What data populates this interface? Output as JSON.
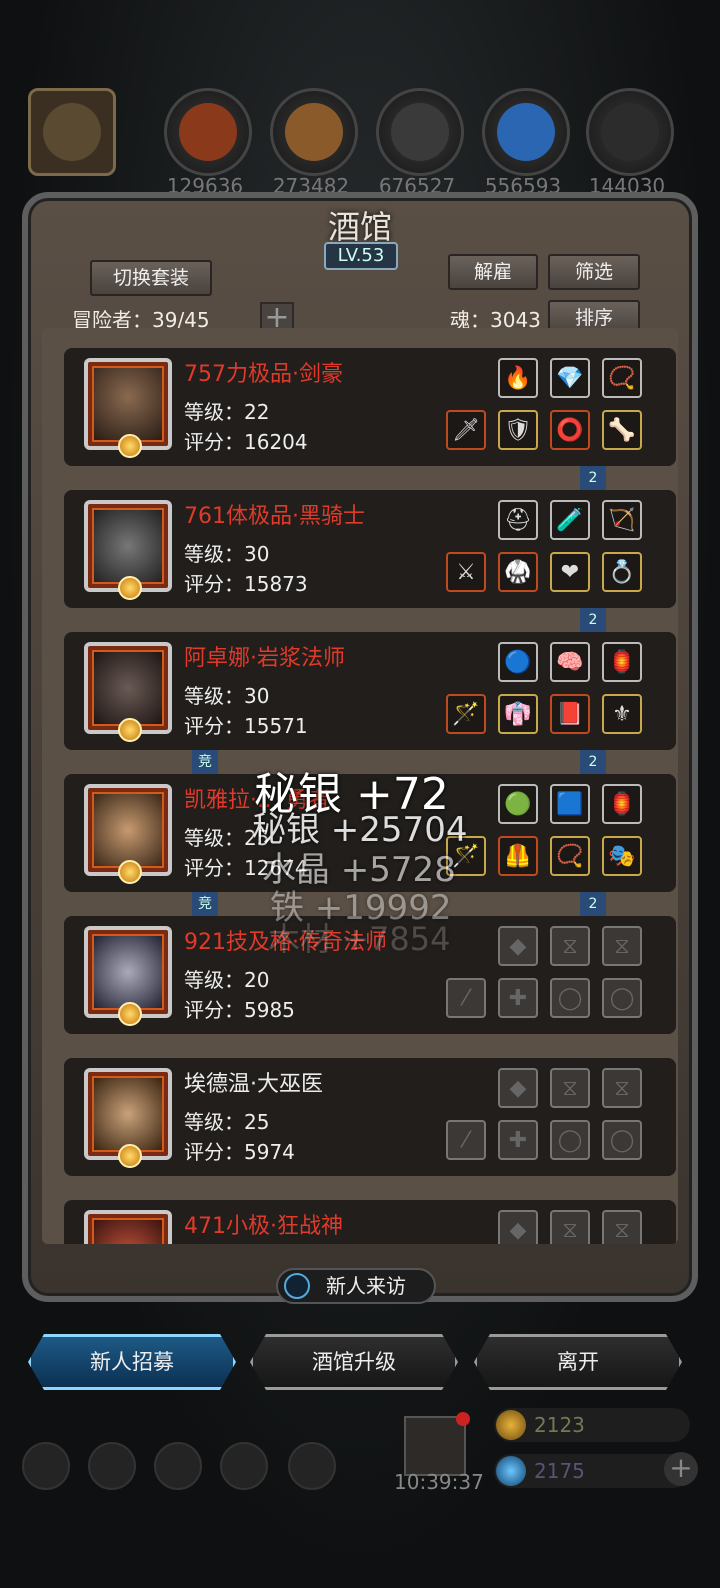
{
  "resources": [
    {
      "name": "tavern-icon",
      "value": ""
    },
    {
      "name": "ore-icon",
      "value": "129636"
    },
    {
      "name": "wood-icon",
      "value": "273482"
    },
    {
      "name": "iron-icon",
      "value": "676527"
    },
    {
      "name": "crystal-icon",
      "value": "556593"
    },
    {
      "name": "stone-icon",
      "value": "144030"
    }
  ],
  "title": "酒馆",
  "level": "LV.53",
  "buttons": {
    "switch_set": "切换套装",
    "dismiss": "解雇",
    "filter": "筛选",
    "sort": "排序"
  },
  "adventurers": "冒险者：39/45",
  "soul": "魂：3043",
  "heroes": [
    {
      "name": "757力极品·剑豪",
      "level": "等级：22",
      "score": "评分：16204",
      "color": "red"
    },
    {
      "name": "761体极品·黑骑士",
      "level": "等级：30",
      "score": "评分：15873",
      "color": "red"
    },
    {
      "name": "阿卓娜·岩浆法师",
      "level": "等级：30",
      "score": "评分：15571",
      "color": "red"
    },
    {
      "name": "凯雅拉·… 勇者",
      "level": "等级：25",
      "score": "评分：12674",
      "color": "red"
    },
    {
      "name": "921技及格·传奇法师",
      "level": "等级：20",
      "score": "评分：5985",
      "color": "red"
    },
    {
      "name": "埃德温·大巫医",
      "level": "等级：25",
      "score": "评分：5974",
      "color": "white"
    },
    {
      "name": "471小极·狂战神",
      "level": "",
      "score": "",
      "color": "red"
    }
  ],
  "flags": {
    "two": "2",
    "arena": "竞"
  },
  "floating": [
    "秘银 +72",
    "秘银 +25704",
    "水晶 +5728",
    "铁 +19992",
    "木材 +7854"
  ],
  "visitor": "新人来访",
  "bottom": {
    "recruit": "新人招募",
    "upgrade": "酒馆升级",
    "leave": "离开"
  },
  "timer": "10:39:37",
  "currency": {
    "gold": "2123",
    "gem": "2175"
  },
  "colors": {
    "accent_blue": "#5bc8ff",
    "hero_red": "#e03a2a"
  }
}
